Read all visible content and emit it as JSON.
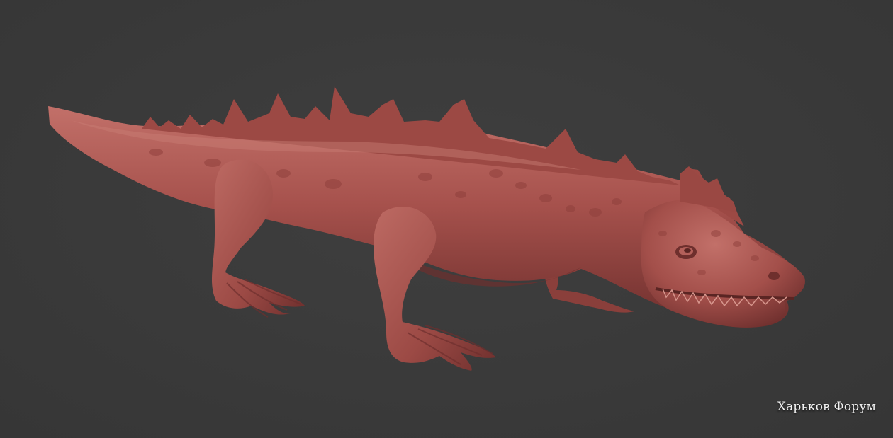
{
  "viewport": {
    "background_color": "#3a3a3a"
  },
  "model": {
    "subject": "sculpted-lizard-creature",
    "clay_color": "#a6514c",
    "shadow_color": "#6e2f2d",
    "highlight_color": "#c67a72"
  },
  "watermark": {
    "text": "Харьков Форум"
  }
}
